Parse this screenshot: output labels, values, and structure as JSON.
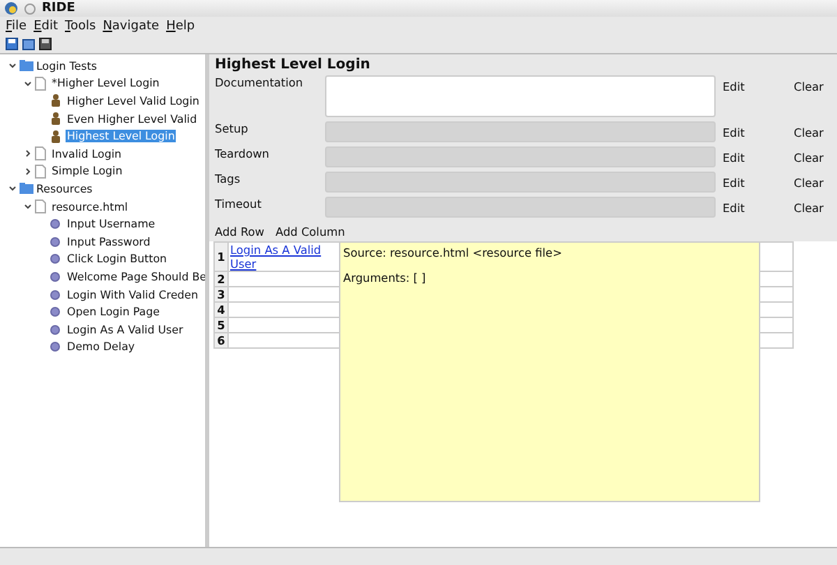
{
  "window": {
    "title": "RIDE"
  },
  "menu": [
    "File",
    "Edit",
    "Tools",
    "Navigate",
    "Help"
  ],
  "tree": [
    {
      "label": "Login Tests",
      "kind": "folder",
      "expanded": true,
      "selected": false,
      "children": [
        {
          "label": "*Higher Level Login",
          "kind": "file",
          "expanded": true,
          "selected": false,
          "children": [
            {
              "label": "Higher Level Valid Login",
              "kind": "test",
              "selected": false
            },
            {
              "label": "Even Higher Level Valid",
              "kind": "test",
              "selected": false
            },
            {
              "label": "Highest Level Login",
              "kind": "test",
              "selected": true
            }
          ]
        },
        {
          "label": "Invalid Login",
          "kind": "file",
          "expanded": false,
          "selected": false
        },
        {
          "label": "Simple Login",
          "kind": "file",
          "expanded": false,
          "selected": false
        }
      ]
    },
    {
      "label": "Resources",
      "kind": "folder",
      "expanded": true,
      "selected": false,
      "children": [
        {
          "label": "resource.html",
          "kind": "file",
          "expanded": true,
          "selected": false,
          "children": [
            {
              "label": "Input Username",
              "kind": "keyword",
              "selected": false
            },
            {
              "label": "Input Password",
              "kind": "keyword",
              "selected": false
            },
            {
              "label": "Click Login Button",
              "kind": "keyword",
              "selected": false
            },
            {
              "label": "Welcome Page Should Be",
              "kind": "keyword",
              "selected": false
            },
            {
              "label": "Login With Valid Creden",
              "kind": "keyword",
              "selected": false
            },
            {
              "label": "Open Login Page",
              "kind": "keyword",
              "selected": false
            },
            {
              "label": "Login As A Valid User",
              "kind": "keyword",
              "selected": false
            },
            {
              "label": "Demo Delay",
              "kind": "keyword",
              "selected": false
            }
          ]
        }
      ]
    }
  ],
  "editor": {
    "title": "Highest Level Login",
    "settings": [
      {
        "label": "Documentation",
        "kind": "text",
        "edit": "Edit",
        "clear": "Clear"
      },
      {
        "label": "Setup",
        "kind": "field",
        "edit": "Edit",
        "clear": "Clear"
      },
      {
        "label": "Teardown",
        "kind": "field",
        "edit": "Edit",
        "clear": "Clear"
      },
      {
        "label": "Tags",
        "kind": "field",
        "edit": "Edit",
        "clear": "Clear"
      },
      {
        "label": "Timeout",
        "kind": "field",
        "edit": "Edit",
        "clear": "Clear"
      }
    ],
    "actions": [
      "Add Row",
      "Add Column"
    ],
    "grid": {
      "rows": [
        {
          "number": "1",
          "cells": [
            "Login As A Valid User"
          ]
        },
        {
          "number": "2",
          "cells": []
        },
        {
          "number": "3",
          "cells": []
        },
        {
          "number": "4",
          "cells": []
        },
        {
          "number": "5",
          "cells": []
        },
        {
          "number": "6",
          "cells": []
        }
      ]
    },
    "tooltip": {
      "source": "Source:  resource.html <resource file>",
      "arguments": "Arguments: [ ]"
    }
  }
}
